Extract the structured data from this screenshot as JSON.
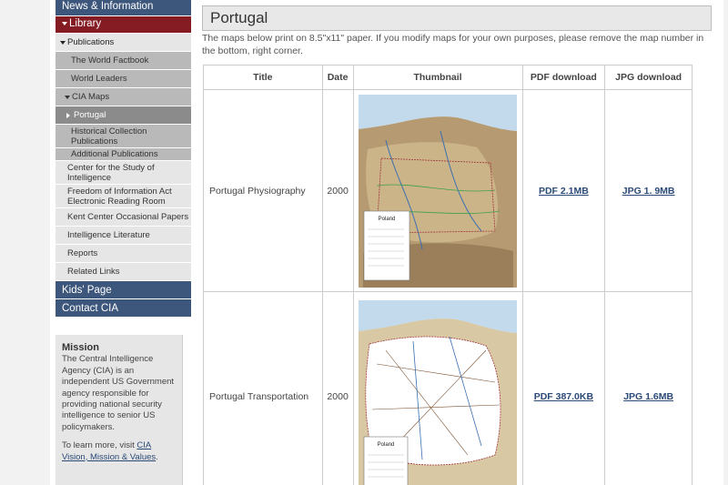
{
  "sidebar": {
    "news": "News & Information",
    "library": "Library",
    "publications": "Publications",
    "world_factbook": "The World Factbook",
    "world_leaders": "World Leaders",
    "cia_maps": "CIA Maps",
    "portugal": "Portugal",
    "historical_1": "Historical Collection",
    "historical_2": "Publications",
    "additional": "Additional Publications",
    "center_1": "Center for the Study of",
    "center_2": "Intelligence",
    "foia_1": "Freedom of Information Act",
    "foia_2": "Electronic Reading Room",
    "kent": "Kent Center Occasional Papers",
    "intel_lit": "Intelligence Literature",
    "reports": "Reports",
    "related": "Related Links",
    "kids": "Kids' Page",
    "contact": "Contact CIA"
  },
  "mission": {
    "heading": "Mission",
    "text": "The Central Intelligence Agency (CIA) is an independent US Government agency responsible for providing national security intelligence to senior US policymakers.",
    "learn_prefix": "To learn more, visit ",
    "learn_link": "CIA Vision, Mission & Values",
    "learn_suffix": "."
  },
  "main": {
    "title": "Portugal",
    "intro": "The maps below print on 8.5\"x11\" paper. If you modify maps for your own purposes, please remove the map number in the bottom, right corner.",
    "columns": [
      "Title",
      "Date",
      "Thumbnail",
      "PDF download",
      "JPG download"
    ],
    "rows": [
      {
        "title": "Portugal Physiography",
        "date": "2000",
        "pdf": "PDF 2.1MB",
        "jpg": "JPG 1. 9MB",
        "map_label": "Poland"
      },
      {
        "title": "Portugal Transportation",
        "date": "2000",
        "pdf": "PDF 387.0KB",
        "jpg": "JPG 1.6MB",
        "map_label": "Poland"
      }
    ]
  },
  "colors": {
    "nav_blue": "#3d567c",
    "nav_red": "#851c23",
    "link": "#2b4a78"
  }
}
